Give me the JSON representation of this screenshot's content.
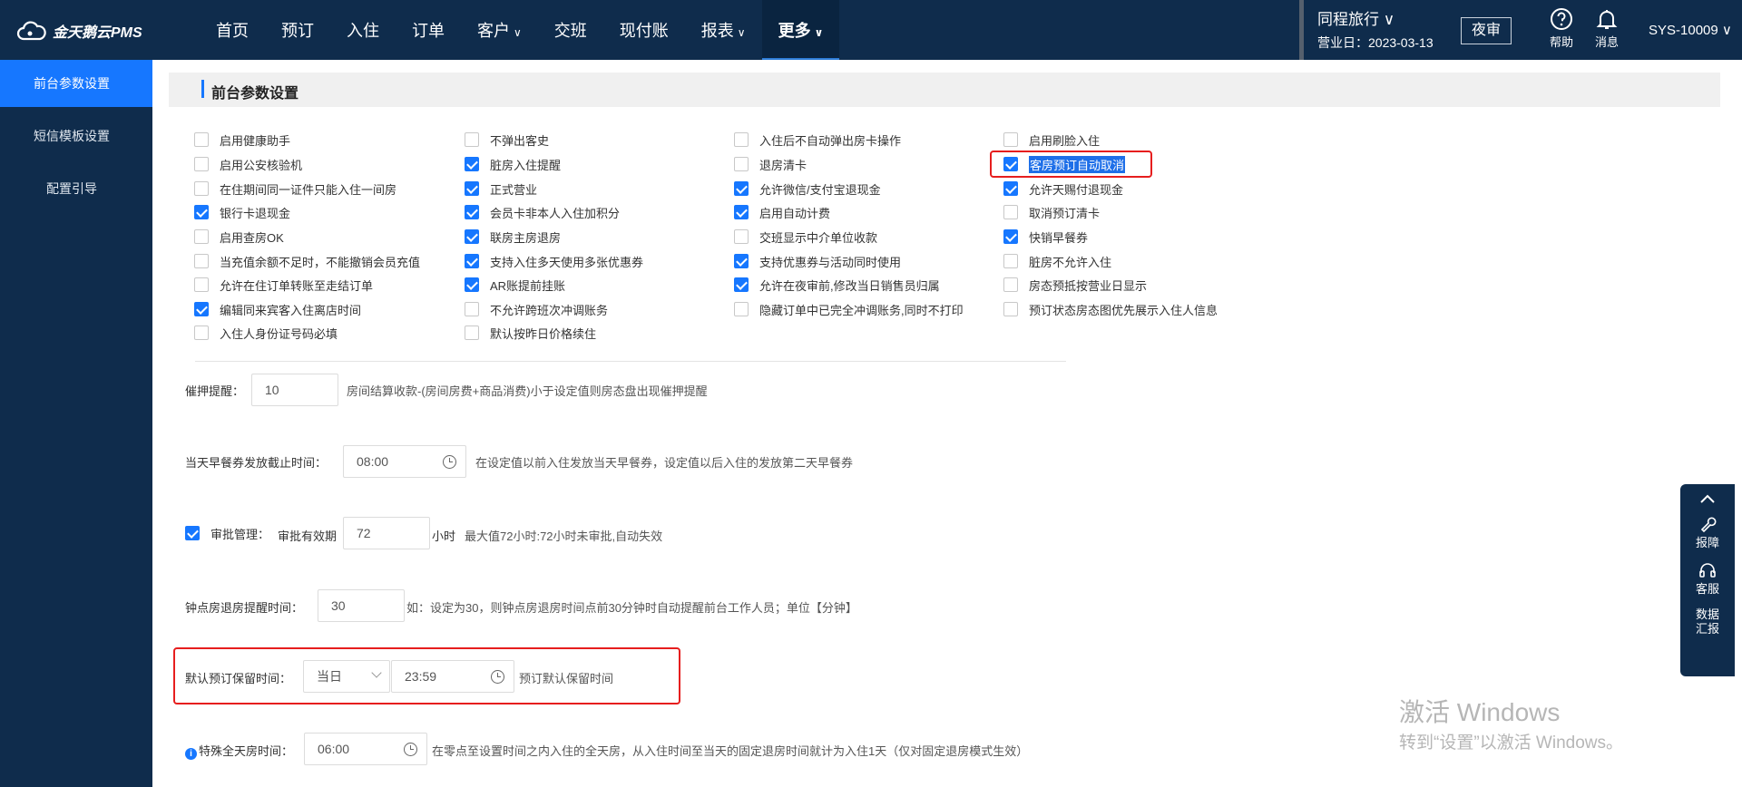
{
  "app": {
    "logo_text": "金天鹅云PMS"
  },
  "nav": [
    {
      "label": "首页",
      "chev": ""
    },
    {
      "label": "预订",
      "chev": ""
    },
    {
      "label": "入住",
      "chev": ""
    },
    {
      "label": "订单",
      "chev": ""
    },
    {
      "label": "客户",
      "chev": "∨"
    },
    {
      "label": "交班",
      "chev": ""
    },
    {
      "label": "现付账",
      "chev": ""
    },
    {
      "label": "报表",
      "chev": "∨"
    },
    {
      "label": "更多",
      "chev": "∨",
      "active": true
    }
  ],
  "header": {
    "hotel": "同程旅行 ∨",
    "business_date": "营业日：2023-03-13",
    "night_audit": "夜审",
    "help": "帮助",
    "messages": "消息",
    "user": "SYS-10009 ∨"
  },
  "sidebar": [
    {
      "label": "前台参数设置",
      "active": true
    },
    {
      "label": "短信模板设置"
    },
    {
      "label": "配置引导"
    }
  ],
  "section_title": "前台参数设置",
  "checkbox_columns": [
    [
      {
        "label": "启用健康助手",
        "checked": false
      },
      {
        "label": "启用公安核验机",
        "checked": false
      },
      {
        "label": "在住期间同一证件只能入住一间房",
        "checked": false
      },
      {
        "label": "银行卡退现金",
        "checked": true
      },
      {
        "label": "启用查房OK",
        "checked": false
      },
      {
        "label": "当充值余额不足时，不能撤销会员充值",
        "checked": false
      },
      {
        "label": "允许在住订单转账至走结订单",
        "checked": false
      },
      {
        "label": "编辑同来宾客入住离店时间",
        "checked": true
      },
      {
        "label": "入住人身份证号码必填",
        "checked": false
      }
    ],
    [
      {
        "label": "不弹出客史",
        "checked": false
      },
      {
        "label": "脏房入住提醒",
        "checked": true
      },
      {
        "label": "正式营业",
        "checked": true
      },
      {
        "label": "会员卡非本人入住加积分",
        "checked": true
      },
      {
        "label": "联房主房退房",
        "checked": true
      },
      {
        "label": "支持入住多天使用多张优惠券",
        "checked": true
      },
      {
        "label": "AR账提前挂账",
        "checked": true
      },
      {
        "label": "不允许跨班次冲调账务",
        "checked": false
      },
      {
        "label": "默认按昨日价格续住",
        "checked": false
      }
    ],
    [
      {
        "label": "入住后不自动弹出房卡操作",
        "checked": false
      },
      {
        "label": "退房清卡",
        "checked": false
      },
      {
        "label": "允许微信/支付宝退现金",
        "checked": true
      },
      {
        "label": "启用自动计费",
        "checked": true
      },
      {
        "label": "交班显示中介单位收款",
        "checked": false
      },
      {
        "label": "支持优惠券与活动同时使用",
        "checked": true
      },
      {
        "label": "允许在夜审前,修改当日销售员归属",
        "checked": true
      },
      {
        "label": "隐藏订单中已完全冲调账务,同时不打印",
        "checked": false
      }
    ],
    [
      {
        "label": "启用刷脸入住",
        "checked": false
      },
      {
        "label": "客房预订自动取消",
        "checked": true,
        "highlight": true
      },
      {
        "label": "允许天赐付退现金",
        "checked": true
      },
      {
        "label": "取消预订清卡",
        "checked": false
      },
      {
        "label": "快销早餐券",
        "checked": true
      },
      {
        "label": "脏房不允许入住",
        "checked": false
      },
      {
        "label": "房态预抵按营业日显示",
        "checked": false
      },
      {
        "label": "预订状态房态图优先展示入住人信息",
        "checked": false
      }
    ]
  ],
  "deposit_reminder": {
    "label": "催押提醒：",
    "value": "10",
    "hint": "房间结算收款-(房间房费+商品消费)小于设定值则房态盘出现催押提醒"
  },
  "breakfast_cutoff": {
    "label": "当天早餐券发放截止时间：",
    "value": "08:00",
    "hint": "在设定值以前入住发放当天早餐券，设定值以后入住的发放第二天早餐券"
  },
  "approval": {
    "label": "审批管理：",
    "validity_label": "审批有效期",
    "value": "72",
    "unit": "小时",
    "hint": "最大值72小时:72小时未审批,自动失效",
    "checked": true
  },
  "hourly_checkout": {
    "label": "钟点房退房提醒时间：",
    "value": "30",
    "hint": "如：设定为30，则钟点房退房时间点前30分钟时自动提醒前台工作人员；单位【分钟】"
  },
  "default_hold": {
    "label": "默认预订保留时间：",
    "day_value": "当日",
    "time_value": "23:59",
    "hint": "预订默认保留时间"
  },
  "special_fullday": {
    "info": "i",
    "label": "特殊全天房时间：",
    "value": "06:00",
    "hint": "在零点至设置时间之内入住的全天房，从入住时间至当天的固定退房时间就计为入住1天（仅对固定退房模式生效）"
  },
  "float_panel": {
    "repair": "报障",
    "service": "客服",
    "report_1": "数据",
    "report_2": "汇报"
  },
  "watermark": {
    "line1": "激活 Windows",
    "line2": "转到“设置”以激活 Windows。"
  }
}
